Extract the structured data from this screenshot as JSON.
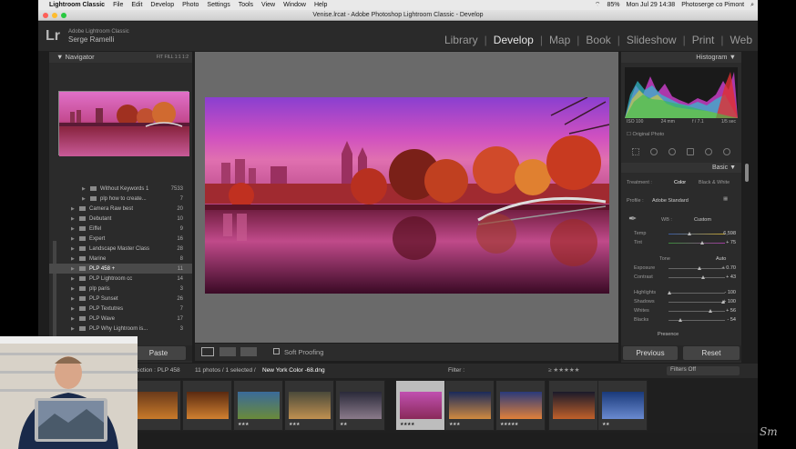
{
  "menubar": {
    "app": "Lightroom Classic",
    "items": [
      "File",
      "Edit",
      "Develop",
      "Photo",
      "Settings",
      "Tools",
      "View",
      "Window",
      "Help"
    ],
    "clock": "Mon Jul 29  14:38",
    "battery": "85%",
    "user": "Photoserge co Pimont"
  },
  "window": {
    "title": "Venise.lrcat - Adobe Photoshop Lightroom Classic - Develop"
  },
  "identity": {
    "logo": "Lr",
    "sub": "Adobe Lightroom Classic",
    "user": "Serge Ramelli"
  },
  "modules": [
    "Library",
    "Develop",
    "Map",
    "Book",
    "Slideshow",
    "Print",
    "Web"
  ],
  "active_module": "Develop",
  "navigator": {
    "title": "Navigator",
    "options": "FIT   FILL   1:1   1:2"
  },
  "folders": [
    {
      "label": "Without Keywords 1",
      "count": "7533",
      "sub": true
    },
    {
      "label": "plp how to create...",
      "count": "7",
      "sub": true
    },
    {
      "label": "Camera Raw best",
      "count": "20"
    },
    {
      "label": "Debutant",
      "count": "10"
    },
    {
      "label": "Eiffel",
      "count": "9"
    },
    {
      "label": "Expert",
      "count": "16"
    },
    {
      "label": "Landscape Master Class",
      "count": "28"
    },
    {
      "label": "Marine",
      "count": "8"
    },
    {
      "label": "PLP 458  +",
      "count": "11",
      "selected": true
    },
    {
      "label": "PLP Lightroom cc",
      "count": "14"
    },
    {
      "label": "plp paris",
      "count": "3"
    },
    {
      "label": "PLP Sunset",
      "count": "26"
    },
    {
      "label": "PLP Textutres",
      "count": "7"
    },
    {
      "label": "PLP Wave",
      "count": "17"
    },
    {
      "label": "PLP Why Lightroom is...",
      "count": "3"
    }
  ],
  "left_buttons": {
    "paste": "Paste"
  },
  "toolbar": {
    "soft_proofing": "Soft Proofing"
  },
  "histogram": {
    "title": "Histogram",
    "iso": "ISO 100",
    "focal": "24 mm",
    "aperture": "f / 7.1",
    "shutter": "1/5 sec",
    "original": "Original Photo"
  },
  "basic": {
    "title": "Basic",
    "treatment_label": "Treatment :",
    "treatment_color": "Color",
    "treatment_bw": "Black & White",
    "profile_label": "Profile :",
    "profile_value": "Adobe Standard",
    "wb_label": "WB :",
    "wb_value": "Custom",
    "tone_label": "Tone",
    "auto_label": "Auto",
    "presence_label": "Presence",
    "sliders": [
      {
        "label": "Temp",
        "value": "6,598",
        "pos": 0.38
      },
      {
        "label": "Tint",
        "value": "+ 75",
        "pos": 0.6
      },
      {
        "label": "Exposure",
        "value": "+ 0.70",
        "pos": 0.55
      },
      {
        "label": "Contrast",
        "value": "+ 43",
        "pos": 0.62
      },
      {
        "label": "Highlights",
        "value": "- 100",
        "pos": 0.03
      },
      {
        "label": "Shadows",
        "value": "+ 100",
        "pos": 0.97
      },
      {
        "label": "Whites",
        "value": "+ 56",
        "pos": 0.75
      },
      {
        "label": "Blacks",
        "value": "- 54",
        "pos": 0.22
      }
    ]
  },
  "right_buttons": {
    "previous": "Previous",
    "reset": "Reset"
  },
  "filmbar": {
    "collection": "ection : PLP 458",
    "info": "11 photos / 1 selected /",
    "file": "New York Color -68.dng",
    "filter_label": "Filter :",
    "filter_value": "Filters Off"
  },
  "filmstrip": [
    {
      "stars": "",
      "colors": [
        "#6a3a1a",
        "#c87a2a"
      ]
    },
    {
      "stars": "",
      "colors": [
        "#5a2a10",
        "#d08030"
      ]
    },
    {
      "stars": "★★★",
      "colors": [
        "#3a6a9a",
        "#6a8a3a"
      ]
    },
    {
      "stars": "★★★",
      "colors": [
        "#4a4a3a",
        "#c09050"
      ]
    },
    {
      "stars": "★★",
      "colors": [
        "#2a2a3a",
        "#8a7a8a"
      ]
    },
    {
      "stars": "★★★★",
      "colors": [
        "#c050b0",
        "#8a2a5a"
      ],
      "selected": true
    },
    {
      "stars": "★★★",
      "colors": [
        "#1a2a5a",
        "#d08a40"
      ]
    },
    {
      "stars": "★★★★★",
      "colors": [
        "#2a3a7a",
        "#e0803a"
      ]
    },
    {
      "stars": "",
      "colors": [
        "#1a1a2a",
        "#c0602a"
      ]
    },
    {
      "stars": "★★",
      "colors": [
        "#1a3a7a",
        "#6a8ad0"
      ]
    }
  ]
}
